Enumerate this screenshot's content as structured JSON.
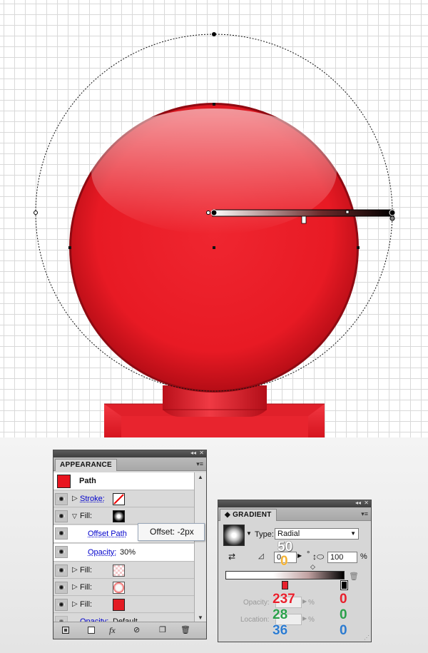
{
  "appearance_panel": {
    "tab": "APPEARANCE",
    "collapse_glyph": "◂◂",
    "close_glyph": "✕",
    "menu_glyph": "▾≡",
    "header": {
      "label": "Path",
      "swatch_color": "#e8141f"
    },
    "rows": {
      "stroke": {
        "label": "Stroke:"
      },
      "fill_open": {
        "label": "Fill:"
      },
      "offset_path": {
        "label": "Offset Path"
      },
      "opacity_inner": {
        "label": "Opacity:",
        "value": "30%"
      },
      "fill_2": {
        "label": "Fill:"
      },
      "fill_3": {
        "label": "Fill:"
      },
      "fill_4": {
        "label": "Fill:",
        "swatch_color": "#e31b23"
      },
      "opacity_outer": {
        "label": "Opacity:",
        "value": "Default"
      }
    },
    "footer": {
      "fx_label": "fx"
    },
    "tooltip": "Offset: -2px"
  },
  "gradient_panel": {
    "tab": "GRADIENT",
    "collapse_glyph": "◂◂",
    "close_glyph": "✕",
    "menu_glyph": "▾≡",
    "type_label": "Type:",
    "type_value": "Radial",
    "angle_value": "0",
    "angle_unit": "°",
    "aspect_value": "100",
    "aspect_unit": "%",
    "overlay_top": "50",
    "overlay_bottom": "0",
    "opacity_label": "Opacity:",
    "location_label": "Location:",
    "pct1": "%",
    "pct2": "%",
    "left_stop_values": [
      "237",
      "28",
      "36"
    ],
    "right_stop_values": [
      "0",
      "0",
      "0"
    ],
    "value_colors": [
      "#e8202c",
      "#2aa04a",
      "#2c7bd0"
    ],
    "stop_overlay_color": "#f2b134"
  }
}
